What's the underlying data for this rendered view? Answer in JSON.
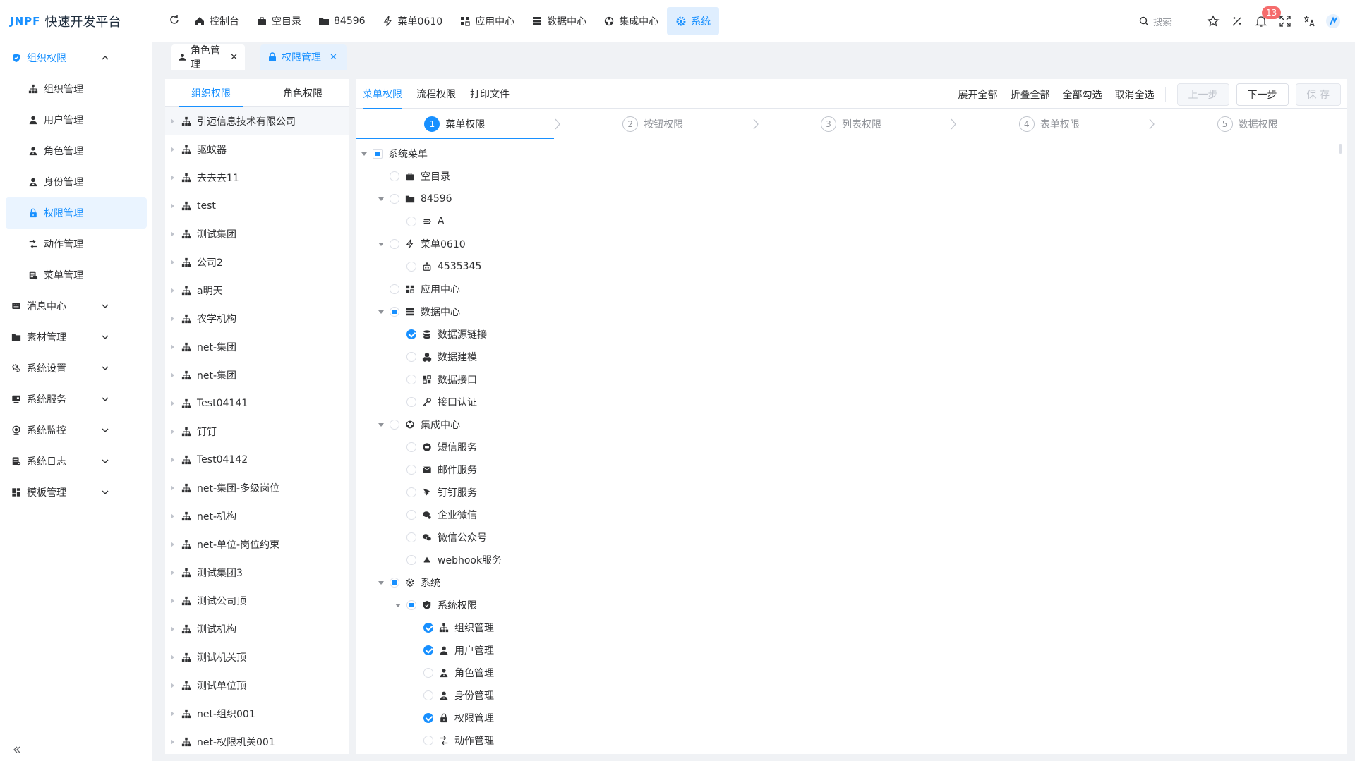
{
  "app": {
    "logo_mark": "JNPF",
    "title": "快速开发平台"
  },
  "topnav": [
    {
      "label": "控制台",
      "icon": "home-icon"
    },
    {
      "label": "空目录",
      "icon": "briefcase-icon"
    },
    {
      "label": "84596",
      "icon": "folder-icon"
    },
    {
      "label": "菜单0610",
      "icon": "bolt-icon"
    },
    {
      "label": "应用中心",
      "icon": "grid-icon"
    },
    {
      "label": "数据中心",
      "icon": "server-icon"
    },
    {
      "label": "集成中心",
      "icon": "network-icon"
    },
    {
      "label": "系统",
      "icon": "gear-icon",
      "active": true
    }
  ],
  "header": {
    "search_placeholder": "搜索",
    "notifications": "13"
  },
  "sidebar": {
    "group": {
      "label": "组织权限",
      "icon": "shield-icon"
    },
    "items": [
      {
        "label": "组织管理",
        "icon": "org-icon"
      },
      {
        "label": "用户管理",
        "icon": "user-icon"
      },
      {
        "label": "角色管理",
        "icon": "role-icon"
      },
      {
        "label": "身份管理",
        "icon": "identity-icon"
      },
      {
        "label": "权限管理",
        "icon": "lock-icon",
        "active": true
      },
      {
        "label": "动作管理",
        "icon": "action-icon"
      },
      {
        "label": "菜单管理",
        "icon": "menu-icon"
      }
    ],
    "groups": [
      {
        "label": "消息中心",
        "icon": "message-icon"
      },
      {
        "label": "素材管理",
        "icon": "folder-icon"
      },
      {
        "label": "系统设置",
        "icon": "settings-icon"
      },
      {
        "label": "系统服务",
        "icon": "service-icon"
      },
      {
        "label": "系统监控",
        "icon": "monitor-icon"
      },
      {
        "label": "系统日志",
        "icon": "log-icon"
      },
      {
        "label": "模板管理",
        "icon": "template-icon"
      }
    ]
  },
  "tags": [
    {
      "label": "角色管理",
      "icon": "role-icon"
    },
    {
      "label": "权限管理",
      "icon": "lock-icon",
      "active": true
    }
  ],
  "left_panel": {
    "tabs": [
      "组织权限",
      "角色权限"
    ],
    "orgs": [
      "引迈信息技术有限公司",
      "驱蚊器",
      "去去去11",
      "test",
      "测试集团",
      "公司2",
      "a明天",
      "农学机构",
      "net-集团",
      "net-集团",
      "Test04141",
      "钉钉",
      "Test04142",
      "net-集团-多级岗位",
      "net-机构",
      "net-单位-岗位约束",
      "测试集团3",
      "测试公司顶",
      "测试机构",
      "测试机关顶",
      "测试单位顶",
      "net-组织001",
      "net-权限机关001"
    ]
  },
  "main": {
    "tabs": [
      "菜单权限",
      "流程权限",
      "打印文件"
    ],
    "actions": {
      "expand_all": "展开全部",
      "collapse_all": "折叠全部",
      "check_all": "全部勾选",
      "uncheck_all": "取消全选",
      "prev": "上一步",
      "next": "下一步",
      "save": "保 存"
    },
    "steps": [
      {
        "num": "1",
        "label": "菜单权限"
      },
      {
        "num": "2",
        "label": "按钮权限"
      },
      {
        "num": "3",
        "label": "列表权限"
      },
      {
        "num": "4",
        "label": "表单权限"
      },
      {
        "num": "5",
        "label": "数据权限"
      }
    ],
    "tree": [
      {
        "label": "系统菜单",
        "level": 0,
        "caret": true,
        "state": "half",
        "icon": ""
      },
      {
        "label": "空目录",
        "level": 1,
        "caret": false,
        "state": "none",
        "icon": "briefcase-icon"
      },
      {
        "label": "84596",
        "level": 1,
        "caret": true,
        "state": "none",
        "icon": "folder-icon"
      },
      {
        "label": "A",
        "level": 2,
        "caret": false,
        "state": "none",
        "icon": "stack-icon"
      },
      {
        "label": "菜单0610",
        "level": 1,
        "caret": true,
        "state": "none",
        "icon": "bolt-icon"
      },
      {
        "label": "4535345",
        "level": 2,
        "caret": false,
        "state": "none",
        "icon": "robot-icon"
      },
      {
        "label": "应用中心",
        "level": 1,
        "caret": false,
        "state": "none",
        "icon": "grid-icon"
      },
      {
        "label": "数据中心",
        "level": 1,
        "caret": true,
        "state": "half",
        "icon": "server-icon"
      },
      {
        "label": "数据源链接",
        "level": 2,
        "caret": false,
        "state": "on",
        "icon": "database-icon"
      },
      {
        "label": "数据建模",
        "level": 2,
        "caret": false,
        "state": "none",
        "icon": "cubes-icon"
      },
      {
        "label": "数据接口",
        "level": 2,
        "caret": false,
        "state": "none",
        "icon": "api-icon"
      },
      {
        "label": "接口认证",
        "level": 2,
        "caret": false,
        "state": "none",
        "icon": "key-icon"
      },
      {
        "label": "集成中心",
        "level": 1,
        "caret": true,
        "state": "none",
        "icon": "network-icon"
      },
      {
        "label": "短信服务",
        "level": 2,
        "caret": false,
        "state": "none",
        "icon": "sms-icon"
      },
      {
        "label": "邮件服务",
        "level": 2,
        "caret": false,
        "state": "none",
        "icon": "mail-icon"
      },
      {
        "label": "钉钉服务",
        "level": 2,
        "caret": false,
        "state": "none",
        "icon": "dingtalk-icon"
      },
      {
        "label": "企业微信",
        "level": 2,
        "caret": false,
        "state": "none",
        "icon": "wecom-icon"
      },
      {
        "label": "微信公众号",
        "level": 2,
        "caret": false,
        "state": "none",
        "icon": "wechat-icon"
      },
      {
        "label": "webhook服务",
        "level": 2,
        "caret": false,
        "state": "none",
        "icon": "webhook-icon"
      },
      {
        "label": "系统",
        "level": 1,
        "caret": true,
        "state": "half",
        "icon": "gear-icon"
      },
      {
        "label": "系统权限",
        "level": 2,
        "caret": true,
        "state": "half",
        "icon": "shield-icon"
      },
      {
        "label": "组织管理",
        "level": 3,
        "caret": false,
        "state": "on",
        "icon": "org-icon"
      },
      {
        "label": "用户管理",
        "level": 3,
        "caret": false,
        "state": "on",
        "icon": "user-icon"
      },
      {
        "label": "角色管理",
        "level": 3,
        "caret": false,
        "state": "none",
        "icon": "role-icon"
      },
      {
        "label": "身份管理",
        "level": 3,
        "caret": false,
        "state": "none",
        "icon": "identity-icon"
      },
      {
        "label": "权限管理",
        "level": 3,
        "caret": false,
        "state": "on",
        "icon": "lock-icon"
      },
      {
        "label": "动作管理",
        "level": 3,
        "caret": false,
        "state": "none",
        "icon": "action-icon"
      }
    ]
  },
  "colors": {
    "accent": "#1890ff",
    "bg": "#f0f2f5"
  }
}
